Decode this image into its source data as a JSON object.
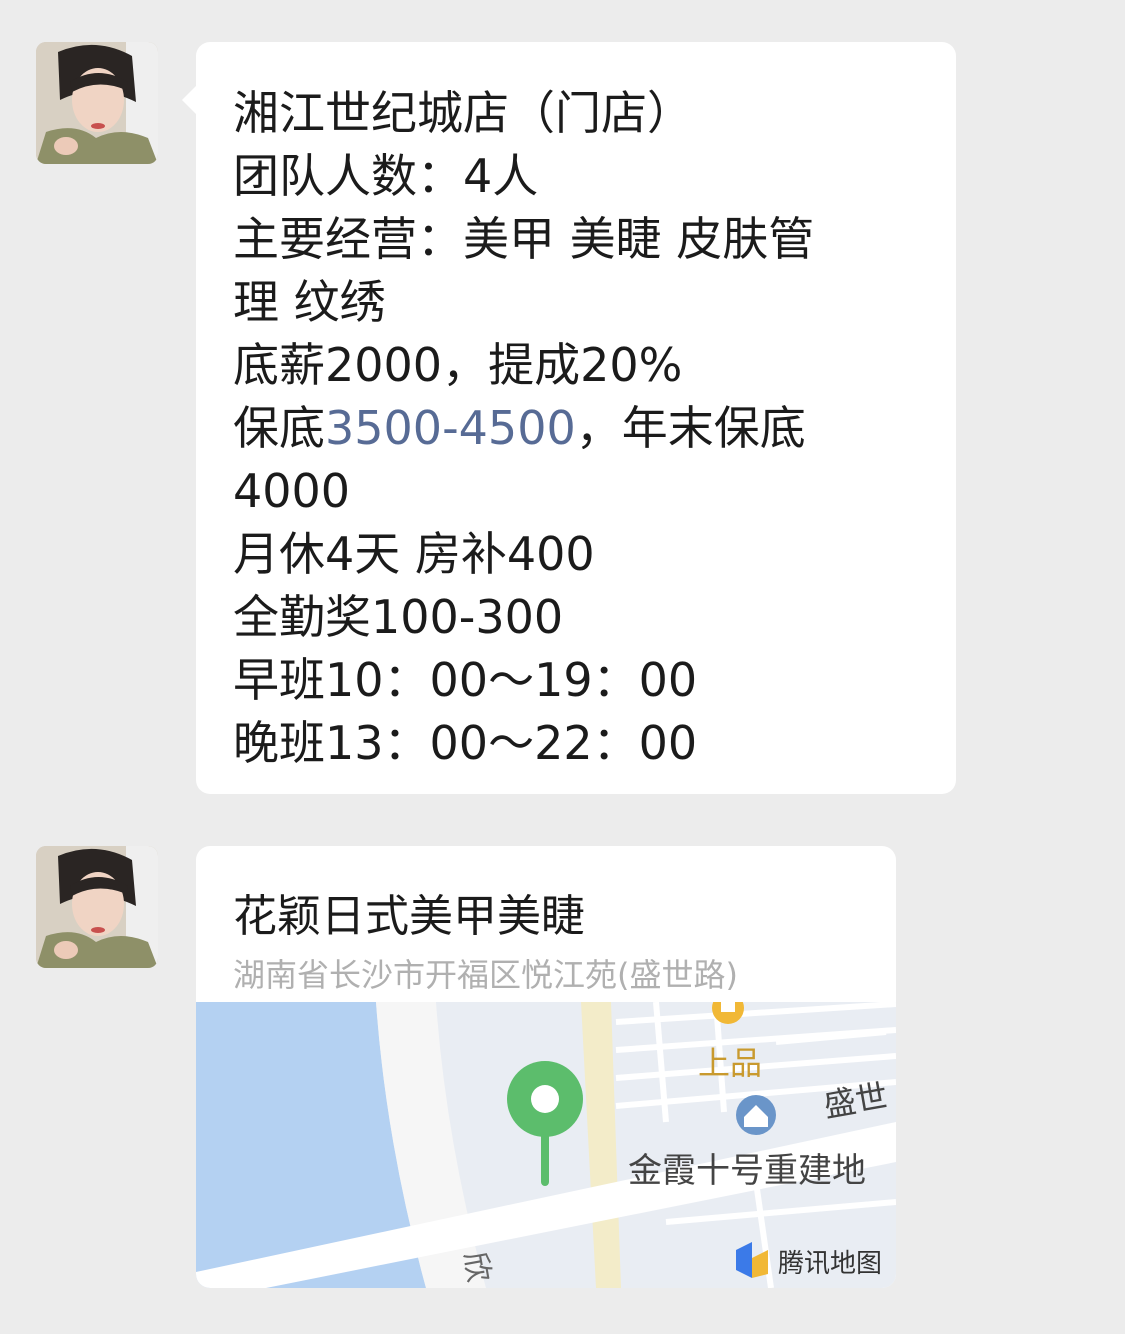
{
  "messages": [
    {
      "type": "text",
      "lines": [
        "湘江世纪城店（门店）",
        "团队人数：4人",
        "主要经营：美甲  美睫   皮肤管",
        "理   纹绣",
        "底薪2000，提成20%",
        [
          "保底",
          "3500-4500",
          "，年末保底"
        ],
        "4000",
        "月休4天  房补400",
        "全勤奖100-300",
        "早班10：00～19：00",
        "晚班13：00～22：00"
      ]
    },
    {
      "type": "location",
      "title": "花颖日式美甲美睫",
      "address": "湖南省长沙市开福区悦江苑(盛世路)",
      "map": {
        "labels": {
          "shangpin": "上品",
          "shengshi": "盛世",
          "jinxia": "金霞十号重建地",
          "xin": "欣",
          "provider": "腾讯地图"
        },
        "colors": {
          "water": "#b4d1f2",
          "land": "#e9edf3",
          "road": "#ffffff",
          "main_road": "#f3ecc9",
          "pin": "#5cbd6c",
          "poi": "#f1b836",
          "home_icon": "#6a95c9"
        }
      }
    }
  ],
  "colors": {
    "background": "#ececec",
    "bubble": "#ffffff",
    "text": "#1b1b1b",
    "link": "#576b95",
    "address": "#b0b0b0"
  }
}
